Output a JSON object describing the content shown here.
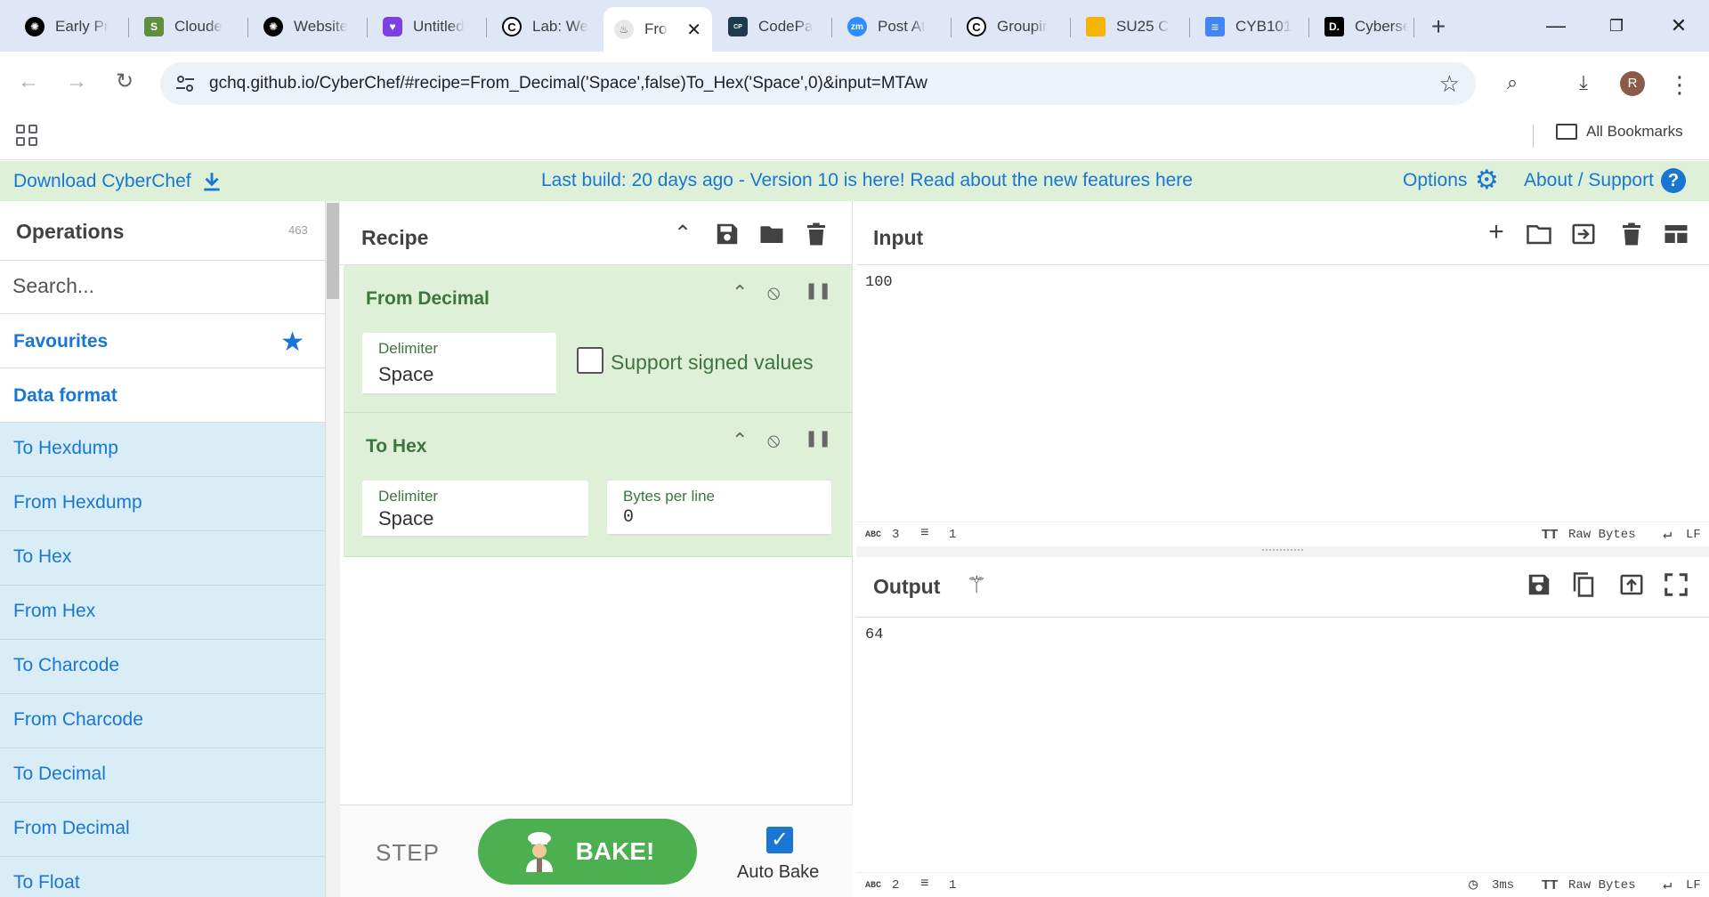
{
  "browser": {
    "tabs": [
      {
        "label": "Early Pr",
        "icon": "openai-icon",
        "color": "#000000"
      },
      {
        "label": "Cloude",
        "icon": "shopify-icon",
        "color": "#5e8e3e"
      },
      {
        "label": "Website",
        "icon": "openai-icon",
        "color": "#000000"
      },
      {
        "label": "Untitled",
        "icon": "heart-icon",
        "color": "#7b3fe4"
      },
      {
        "label": "Lab: We",
        "icon": "codepath-icon",
        "color": "#000000"
      },
      {
        "label": "Fro",
        "icon": "cyberchef-icon",
        "color": "#999999"
      },
      {
        "label": "CodePa",
        "icon": "codepath-logo-icon",
        "color": "#1d3b4f"
      },
      {
        "label": "Post At",
        "icon": "zoom-icon",
        "color": "#2d8cff"
      },
      {
        "label": "Groupir",
        "icon": "codepath-icon",
        "color": "#000000"
      },
      {
        "label": "SU25 C",
        "icon": "slides-icon",
        "color": "#f4b400"
      },
      {
        "label": "CYB101",
        "icon": "docs-icon",
        "color": "#4285f4"
      },
      {
        "label": "Cyberse",
        "icon": "d-icon",
        "color": "#000000"
      }
    ],
    "url": "gchq.github.io/CyberChef/#recipe=From_Decimal('Space',false)To_Hex('Space',0)&input=MTAw",
    "avatar_letter": "R",
    "bookmarks_label": "All Bookmarks"
  },
  "banner": {
    "download": "Download CyberChef",
    "message": "Last build: 20 days ago - Version 10 is here! Read about the new features here",
    "options": "Options",
    "about": "About / Support"
  },
  "operations": {
    "title": "Operations",
    "count": "463",
    "search_placeholder": "Search...",
    "favourites": "Favourites",
    "category": "Data format",
    "items": [
      "To Hexdump",
      "From Hexdump",
      "To Hex",
      "From Hex",
      "To Charcode",
      "From Charcode",
      "To Decimal",
      "From Decimal",
      "To Float"
    ]
  },
  "recipe": {
    "title": "Recipe",
    "ops": [
      {
        "name": "From Decimal",
        "delimiter_label": "Delimiter",
        "delimiter_value": "Space",
        "checkbox_label": "Support signed values"
      },
      {
        "name": "To Hex",
        "delimiter_label": "Delimiter",
        "delimiter_value": "Space",
        "bpl_label": "Bytes per line",
        "bpl_value": "0"
      }
    ],
    "step": "STEP",
    "bake": "BAKE!",
    "auto_bake": "Auto Bake"
  },
  "input": {
    "title": "Input",
    "text": "100",
    "chars": "3",
    "lines": "1",
    "encoding": "Raw Bytes",
    "eol": "LF"
  },
  "output": {
    "title": "Output",
    "text": "64",
    "chars": "2",
    "lines": "1",
    "time": "3ms",
    "encoding": "Raw Bytes",
    "eol": "LF"
  }
}
